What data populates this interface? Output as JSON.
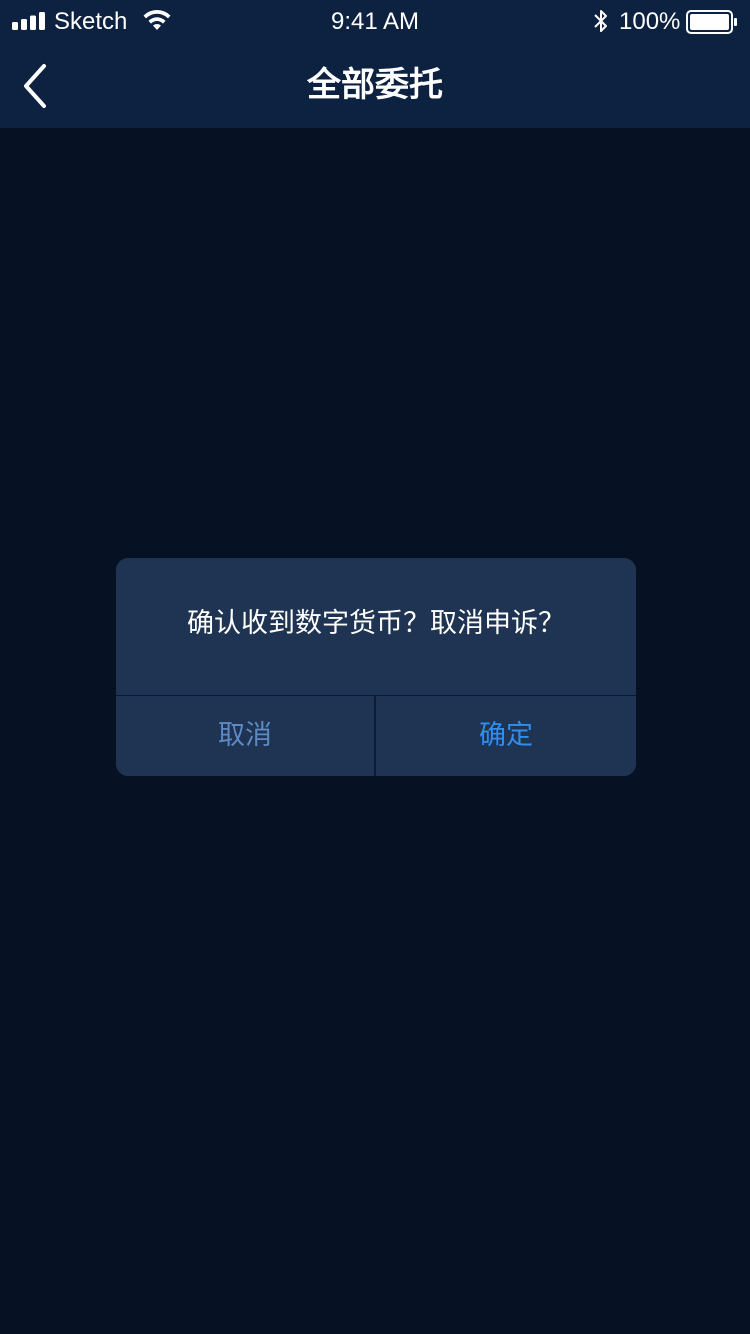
{
  "status_bar": {
    "carrier": "Sketch",
    "time": "9:41 AM",
    "battery_percent": "100%",
    "icons": [
      "signal-icon",
      "wifi-icon",
      "bluetooth-icon",
      "battery-icon"
    ]
  },
  "nav": {
    "title": "全部委托",
    "back_icon": "chevron-left-icon"
  },
  "dialog": {
    "message": "确认收到数字货币？取消申诉？",
    "cancel_label": "取消",
    "confirm_label": "确定"
  },
  "colors": {
    "background": "#061224",
    "bar_background": "#0d2140",
    "dialog_background": "#1f3352",
    "cancel_text": "#5d8ac4",
    "confirm_text": "#2f8ef0"
  }
}
